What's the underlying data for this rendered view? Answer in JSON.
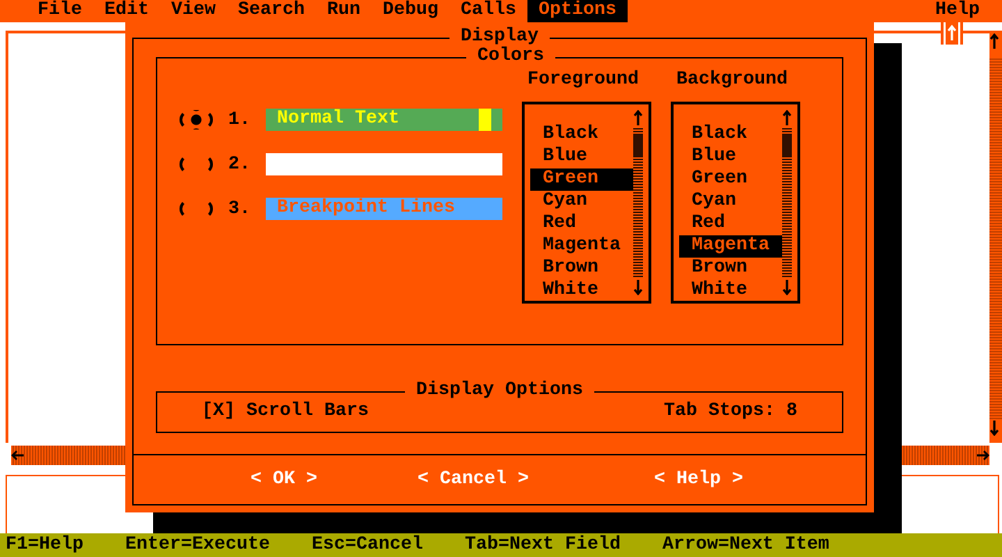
{
  "menu": [
    {
      "label": "File",
      "selected": false
    },
    {
      "label": "Edit",
      "selected": false
    },
    {
      "label": "View",
      "selected": false
    },
    {
      "label": "Search",
      "selected": false
    },
    {
      "label": "Run",
      "selected": false
    },
    {
      "label": "Debug",
      "selected": false
    },
    {
      "label": "Calls",
      "selected": false
    },
    {
      "label": "Options",
      "selected": true
    }
  ],
  "help_menu": {
    "label": "Help",
    "selected": false
  },
  "dialog": {
    "title": "Display",
    "colors_title": "Colors",
    "color_items": [
      {
        "number": "1.",
        "selected": true,
        "sample": {
          "text": "Normal Text",
          "kind": "normal"
        },
        "color": "#55aa55"
      },
      {
        "number": "2.",
        "selected": false,
        "color": "#ffffff"
      },
      {
        "number": "3.",
        "selected": false,
        "sample": {
          "text": "Breakpoint Lines",
          "kind": "breakpoint"
        },
        "color": "#55aaff"
      }
    ],
    "foreground_title": "Foreground",
    "background_title": "Background",
    "foreground": [
      {
        "label": "Black",
        "selected": false
      },
      {
        "label": "Blue",
        "selected": false
      },
      {
        "label": "Green",
        "selected": true
      },
      {
        "label": "Cyan",
        "selected": false
      },
      {
        "label": "Red",
        "selected": false
      },
      {
        "label": "Magenta",
        "selected": false
      },
      {
        "label": "Brown",
        "selected": false
      },
      {
        "label": "White",
        "selected": false
      }
    ],
    "background": [
      {
        "label": "Black",
        "selected": false
      },
      {
        "label": "Blue",
        "selected": false
      },
      {
        "label": "Green",
        "selected": false
      },
      {
        "label": "Cyan",
        "selected": false
      },
      {
        "label": "Red",
        "selected": false
      },
      {
        "label": "Magenta",
        "selected": true
      },
      {
        "label": "Brown",
        "selected": false
      },
      {
        "label": "White",
        "selected": false
      }
    ],
    "options_title": "Display Options",
    "scroll_bars": {
      "box": "[X]",
      "label": "Scroll Bars",
      "checked": true
    },
    "tab_stops": {
      "label": "Tab Stops:",
      "value": "8"
    },
    "buttons": [
      "< OK >",
      "< Cancel >",
      "< Help >"
    ]
  },
  "status_bar": [
    "F1=Help",
    "Enter=Execute",
    "Esc=Cancel",
    "Tab=Next Field",
    "Arrow=Next Item"
  ]
}
